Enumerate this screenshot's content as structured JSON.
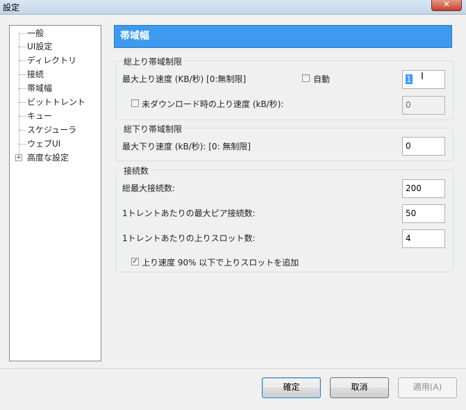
{
  "window": {
    "title": "設定",
    "close_label": "✕"
  },
  "tree": {
    "items": [
      {
        "label": "一般"
      },
      {
        "label": "UI設定"
      },
      {
        "label": "ディレクトリ"
      },
      {
        "label": "接続"
      },
      {
        "label": "帯域幅"
      },
      {
        "label": "ビットトレント"
      },
      {
        "label": "キュー"
      },
      {
        "label": "スケジューラ"
      },
      {
        "label": "ウェブUI"
      },
      {
        "label": "高度な設定"
      }
    ],
    "expander": "+"
  },
  "panel": {
    "title": "帯域幅",
    "upload_group": {
      "title": "総上り帯域制限",
      "max_upload_label": "最大上り速度 (KB/秒) [0:無制限]",
      "auto_label": "自動",
      "auto_checked": false,
      "max_upload_value": "1",
      "no_download_label": "未ダウンロード時の上り速度 (kB/秒):",
      "no_download_checked": false,
      "no_download_value": "0"
    },
    "download_group": {
      "title": "総下り帯域制限",
      "max_download_label": "最大下り速度 (kB/秒): [0: 無制限]",
      "max_download_value": "0"
    },
    "connections_group": {
      "title": "接続数",
      "total_label": "総最大接続数:",
      "total_value": "200",
      "per_torrent_peers_label": "1トレントあたりの最大ピア接続数:",
      "per_torrent_peers_value": "50",
      "upload_slots_label": "1トレントあたりの上りスロット数:",
      "upload_slots_value": "4",
      "extra_slots_label": "上り速度 90% 以下で上りスロットを追加",
      "extra_slots_checked": true
    }
  },
  "buttons": {
    "ok": "確定",
    "cancel": "取消",
    "apply": "適用(A)"
  },
  "glyphs": {
    "check": "✓",
    "ibeam": "I"
  }
}
